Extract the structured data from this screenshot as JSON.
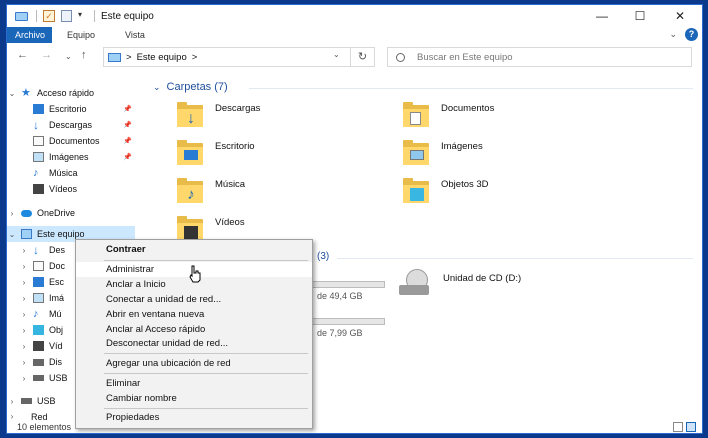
{
  "titlebar": {
    "title": "Este equipo",
    "minimize": "—",
    "maximize": "☐",
    "close": "✕"
  },
  "ribbon": {
    "tabs": [
      "Archivo",
      "Equipo",
      "Vista"
    ]
  },
  "address": {
    "segment": "Este equipo",
    "sep": ">",
    "search_placeholder": "Buscar en Este equipo"
  },
  "sidebar": {
    "quick_access": "Acceso rápido",
    "quick_items": [
      "Escritorio",
      "Descargas",
      "Documentos",
      "Imágenes",
      "Música",
      "Vídeos"
    ],
    "onedrive": "OneDrive",
    "this_pc": "Este equipo",
    "sub_items": [
      "Des",
      "Doc",
      "Esc",
      "Imá",
      "Mú",
      "Obj",
      "Víd",
      "Dis",
      "USB"
    ],
    "usb": "USB",
    "partial": "Red"
  },
  "main": {
    "folders_header": "Carpetas (7)",
    "folders": [
      "Descargas",
      "Documentos",
      "Escritorio",
      "Imágenes",
      "Música",
      "Objetos 3D",
      "Vídeos"
    ],
    "devices_header_suffix": "(3)",
    "drive1_free": "de 49,4 GB",
    "drive2_free": "de 7,99 GB",
    "cd_drive": "Unidad de CD (D:)"
  },
  "status": {
    "count": "10 elementos"
  },
  "context_menu": {
    "items": [
      "Contraer",
      "Administrar",
      "Anclar a Inicio",
      "Conectar a unidad de red...",
      "Abrir en ventana nueva",
      "Anclar al Acceso rápido",
      "Desconectar unidad de red...",
      "Agregar una ubicación de red",
      "Eliminar",
      "Cambiar nombre",
      "Propiedades"
    ]
  },
  "colors": {
    "accent": "#1a66b8",
    "folder": "#ffd76a",
    "selection": "#cce8ff",
    "group_header": "#1f4e9c"
  }
}
